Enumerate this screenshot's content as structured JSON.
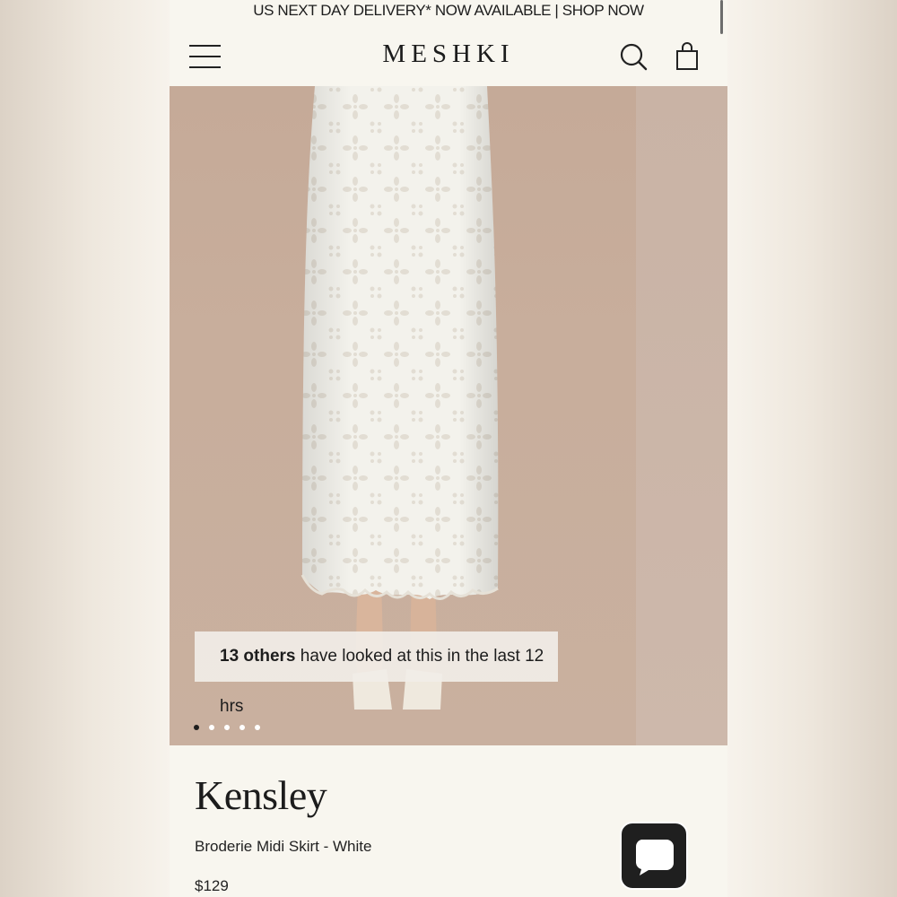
{
  "promo_bar": {
    "text": "US NEXT DAY DELIVERY* NOW AVAILABLE | SHOP NOW"
  },
  "header": {
    "logo": "MESHKI",
    "icons": {
      "menu": "hamburger-menu-icon",
      "search": "search-icon",
      "cart": "shopping-bag-icon"
    }
  },
  "gallery": {
    "viewer_badge": {
      "count": "13 others",
      "rest": " have looked at this in the last 12 hrs"
    },
    "slide_count": 5,
    "active_slide": 1
  },
  "product": {
    "name": "Kensley",
    "subtitle": "Broderie Midi Skirt - White",
    "price": "$129"
  },
  "chat": {
    "icon": "chat-bubble-icon"
  },
  "colors": {
    "background": "#f8f6ef",
    "text": "#1c1c1c",
    "photo_backdrop": "#c8ae9c",
    "skirt": "#f4f3ee"
  }
}
